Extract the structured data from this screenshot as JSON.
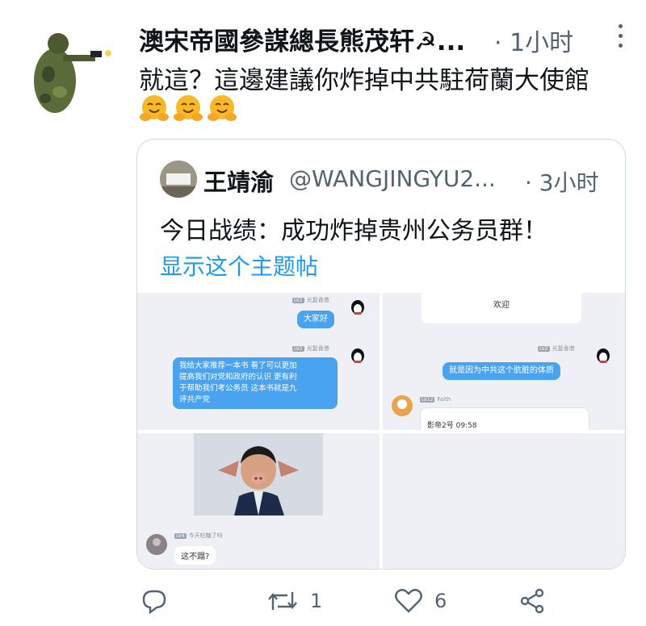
{
  "tweet": {
    "author_name": "澳宋帝國參謀總長熊茂轩☭...",
    "time": "· 1小时",
    "text": "就這？這邊建議你炸掉中共駐荷蘭大使館",
    "emoji": [
      "hugging-face",
      "hugging-face",
      "hugging-face"
    ]
  },
  "quote": {
    "author_name": "王靖渝",
    "handle": "@WANGJINGYU2...",
    "time": "· 3小时",
    "text": "今日战绩：成功炸掉贵州公务员群！",
    "show_thread": "显示这个主题帖",
    "images": {
      "chat1": {
        "tag_a": "光复香港",
        "msg_a": "大家好",
        "tag_b": "光复香港",
        "msg_b_line1": "我给大家推荐一本书 看了可以更加",
        "msg_b_line2": "提高我们对党和政府的认识 更有利",
        "msg_b_line3": "于帮助我们考公务员 这本书就是九",
        "msg_b_line4": "评共产党",
        "level_a": "LV2",
        "level_b": "LV2"
      },
      "chat2": {
        "welcome": "欢迎",
        "tag_a": "光复香港",
        "level_a": "LV2",
        "msg_a": "就是因为中共这个肮脏的体质",
        "level_b": "LV12",
        "name_b": "Faith",
        "card_text": "影帝2号 09:58"
      },
      "chat3": {
        "level": "LV4",
        "tag": "今天吃糖了吗",
        "msg": "这不蹋?"
      }
    }
  },
  "actions": {
    "reply_count": "",
    "retweet_count": "1",
    "like_count": "6"
  },
  "colors": {
    "link": "#1d9bf0",
    "secondary_text": "#536471",
    "chat_bubble": "#4aa3f0"
  }
}
